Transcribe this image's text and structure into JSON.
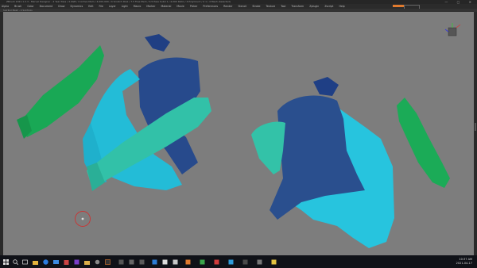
{
  "window": {
    "title": "ZBrush 2021.1.2.3 - Marvel Designer - 4 Year Pass / 4.0GB / 4 Active Mem / 4,000,000 / 4 Scratch Disk / 7.5 Free Mem / 4.5 Pass Subd 1 / 4,000 Ratio / 4 PolyCount / 4 1 / 4 Mesh (Selected)",
    "controls": "— ▢ ✕"
  },
  "menu": {
    "items": [
      "Alpha",
      "Brush",
      "Color",
      "Document",
      "Draw",
      "Dynamics",
      "Edit",
      "File",
      "Layer",
      "Light",
      "Macro",
      "Marker",
      "Material",
      "Movie",
      "Picker",
      "Preferences",
      "Render",
      "Stencil",
      "Stroke",
      "Texture",
      "Tool",
      "Transform",
      "Zplugin",
      "Zscript",
      "Help"
    ]
  },
  "subbar": {
    "text": "SubTool Mesh - 4 SubTools"
  },
  "taskbar": {
    "clock_time": "10:37 AM",
    "clock_date": "2021-04-17"
  },
  "colors": {
    "viewport_bg": "#7d7d7d",
    "accent_orange": "#e07a2e",
    "green": "#19a855",
    "navy": "#284f8f",
    "cyan": "#26c3dc",
    "teal": "#33c3a9"
  },
  "icons": [
    "windows-start-icon",
    "search-icon",
    "task-view-icon",
    "file-explorer-icon",
    "browser-icon",
    "mail-icon",
    "store-icon",
    "zbrush-icon",
    "folder-icon",
    "settings-icon",
    "media-icon"
  ]
}
